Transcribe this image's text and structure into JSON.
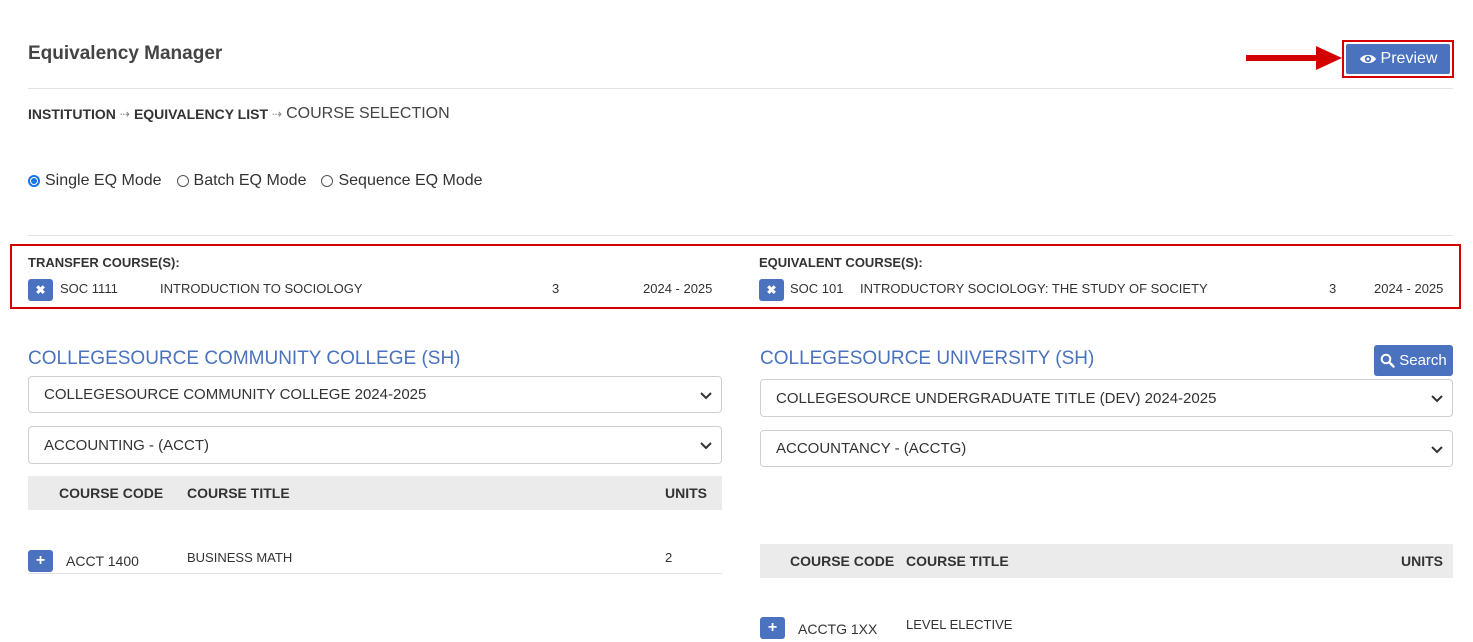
{
  "header": {
    "title": "Equivalency Manager",
    "preview_label": "Preview"
  },
  "breadcrumb": [
    "INSTITUTION",
    "EQUIVALENCY LIST",
    "COURSE SELECTION"
  ],
  "modes": [
    {
      "label": "Single EQ Mode",
      "checked": true
    },
    {
      "label": "Batch EQ Mode",
      "checked": false
    },
    {
      "label": "Sequence EQ Mode",
      "checked": false
    }
  ],
  "selection": {
    "transfer": {
      "heading": "TRANSFER COURSE(S):",
      "code": "SOC 1111",
      "title": "INTRODUCTION TO SOCIOLOGY",
      "units": "3",
      "year": "2024 - 2025"
    },
    "equivalent": {
      "heading": "EQUIVALENT COURSE(S):",
      "code": "SOC 101",
      "title": "INTRODUCTORY SOCIOLOGY: THE STUDY OF SOCIETY",
      "units": "3",
      "year": "2024 - 2025"
    }
  },
  "left": {
    "institution": "COLLEGESOURCE COMMUNITY COLLEGE (SH)",
    "catalog": "COLLEGESOURCE COMMUNITY COLLEGE 2024-2025",
    "subject": "ACCOUNTING - (ACCT)",
    "columns": {
      "code": "COURSE CODE",
      "title": "COURSE TITLE",
      "units": "UNITS"
    },
    "rows": [
      {
        "code": "ACCT 1400",
        "title": "BUSINESS MATH",
        "units": "2"
      }
    ]
  },
  "right": {
    "institution": "COLLEGESOURCE UNIVERSITY (SH)",
    "search_label": "Search",
    "catalog": "COLLEGESOURCE UNDERGRADUATE TITLE (DEV) 2024-2025",
    "subject": "ACCOUNTANCY - (ACCTG)",
    "columns": {
      "code": "COURSE CODE",
      "title": "COURSE TITLE",
      "units": "UNITS"
    },
    "rows": [
      {
        "code": "ACCTG 1XX",
        "title": "LEVEL ELECTIVE",
        "units": ""
      }
    ]
  },
  "colors": {
    "accent": "#4a72be",
    "highlight": "#d40000",
    "radio": "#1a73e8"
  },
  "icons": [
    "eye-icon",
    "arrow-right-icon",
    "close-icon",
    "search-icon",
    "plus-icon",
    "chevron-down-icon"
  ]
}
